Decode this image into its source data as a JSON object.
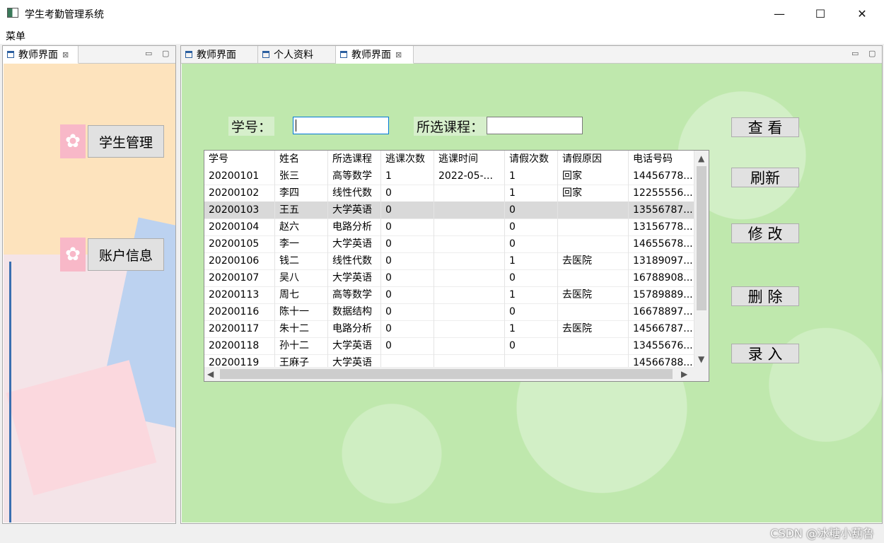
{
  "window": {
    "title": "学生考勤管理系统",
    "controls": {
      "minimize": "—",
      "maximize": "☐",
      "close": "✕"
    }
  },
  "menu": {
    "items": [
      "菜单"
    ]
  },
  "left_panel": {
    "tab_label": "教师界面",
    "tab_close": "⊠",
    "view_min": "▭",
    "view_max": "▢",
    "nav": [
      {
        "label": "学生管理"
      },
      {
        "label": "账户信息"
      }
    ],
    "colors": {
      "bg": "#fde3bd",
      "flower": "#f8b8c8",
      "blue_shape": "#bcd2f0",
      "pink_shape": "#fbd8de"
    }
  },
  "right_panel": {
    "tabs": [
      {
        "label": "教师界面"
      },
      {
        "label": "个人资料"
      },
      {
        "label": "教师界面"
      }
    ],
    "active_tab_close": "⊠",
    "view_min": "▭",
    "view_max": "▢",
    "search": {
      "student_id_label": "学号：",
      "student_id_value": "",
      "course_label": "所选课程：",
      "course_value": ""
    },
    "actions": [
      "查 看",
      "刷新",
      "修 改",
      "删 除",
      "录 入"
    ],
    "table": {
      "columns": [
        "学号",
        "姓名",
        "所选课程",
        "逃课次数",
        "逃课时间",
        "请假次数",
        "请假原因",
        "电话号码"
      ],
      "rows": [
        [
          "20200101",
          "张三",
          "高等数学",
          "1",
          "2022-05-...",
          "1",
          "回家",
          "14456778..."
        ],
        [
          "20200102",
          "李四",
          "线性代数",
          "0",
          "",
          "1",
          "回家",
          "12255556..."
        ],
        [
          "20200103",
          "王五",
          "大学英语",
          "0",
          "",
          "0",
          "",
          "13556787..."
        ],
        [
          "20200104",
          "赵六",
          "电路分析",
          "0",
          "",
          "0",
          "",
          "13156778..."
        ],
        [
          "20200105",
          "李一",
          "大学英语",
          "0",
          "",
          "0",
          "",
          "14655678..."
        ],
        [
          "20200106",
          "钱二",
          "线性代数",
          "0",
          "",
          "1",
          "去医院",
          "13189097..."
        ],
        [
          "20200107",
          "吴八",
          "大学英语",
          "0",
          "",
          "0",
          "",
          "16788908..."
        ],
        [
          "20200113",
          "周七",
          "高等数学",
          "0",
          "",
          "1",
          "去医院",
          "15789889..."
        ],
        [
          "20200116",
          "陈十一",
          "数据结构",
          "0",
          "",
          "0",
          "",
          "16678897..."
        ],
        [
          "20200117",
          "朱十二",
          "电路分析",
          "0",
          "",
          "1",
          "去医院",
          "14566787..."
        ],
        [
          "20200118",
          "孙十二",
          "大学英语",
          "0",
          "",
          "0",
          "",
          "13455676..."
        ],
        [
          "20200119",
          "王麻子",
          "大学英语",
          "",
          "",
          "",
          "",
          "14566788..."
        ]
      ],
      "selected_row": 2,
      "scroll_arrows": {
        "up": "▲",
        "down": "▼",
        "left": "◀",
        "right": "▶"
      }
    },
    "colors": {
      "bg": "#bfe8ad"
    }
  },
  "watermark": "CSDN @冰糖小葫鲁"
}
